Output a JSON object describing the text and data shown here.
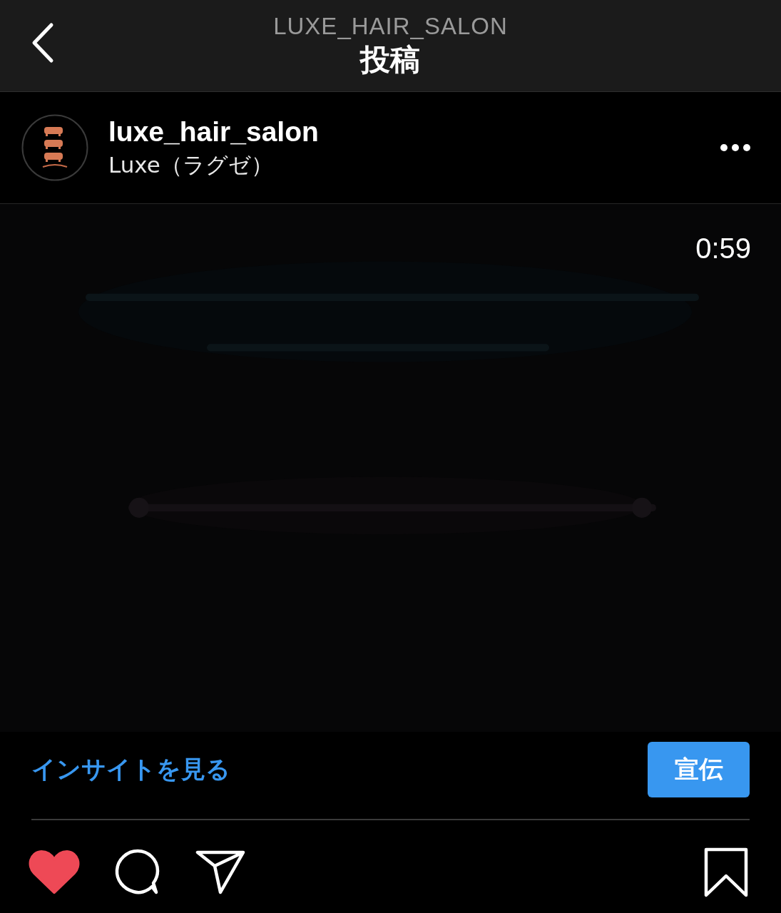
{
  "header": {
    "account": "LUXE_HAIR_SALON",
    "title": "投稿"
  },
  "post": {
    "username": "luxe_hair_salon",
    "subtitle": "Luxe（ラグゼ）",
    "media": {
      "kind": "picture",
      "duration": "0:59"
    }
  },
  "insights_link": "インサイトを見る",
  "promote_button": "宣伝",
  "actions": {
    "liked": true,
    "saved": false
  }
}
